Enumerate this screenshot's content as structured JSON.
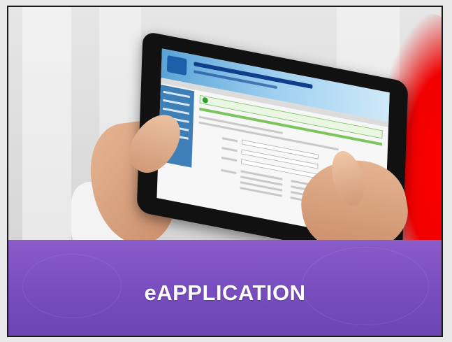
{
  "banner": {
    "title": "eAPPLICATION"
  },
  "colors": {
    "banner": "#7a4fc0",
    "accent_red": "#ff0000",
    "tablet_bezel": "#111111",
    "screen_header": "#5aa3d6"
  },
  "icons": {
    "tablet_screen_logo": "agency-logo-icon"
  }
}
